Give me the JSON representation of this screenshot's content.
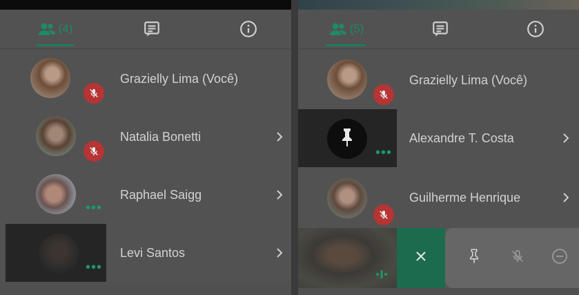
{
  "left_panel": {
    "tabs": {
      "people_count": "(4)",
      "chat_icon": "chat-icon",
      "info_icon": "info-icon"
    },
    "participants": [
      {
        "name": "Grazielly Lima (Você)",
        "status": "muted"
      },
      {
        "name": "Natalia Bonetti",
        "status": "muted"
      },
      {
        "name": "Raphael Saigg",
        "status": "more"
      },
      {
        "name": "Levi Santos",
        "status": "more"
      }
    ]
  },
  "right_panel": {
    "tabs": {
      "people_count": "(5)",
      "chat_icon": "chat-icon",
      "info_icon": "info-icon"
    },
    "participants": [
      {
        "name": "Grazielly Lima (Você)",
        "status": "muted"
      },
      {
        "name": "Alexandre T. Costa",
        "status": "more"
      },
      {
        "name": "Guilherme Henrique",
        "status": "muted"
      }
    ],
    "action_menu": {
      "icons": [
        "close-icon",
        "pin-icon",
        "mute-icon",
        "remove-icon"
      ]
    }
  },
  "colors": {
    "accent": "#1d7f5c",
    "mute_red": "#b73434",
    "background": "#525252",
    "dark_tile": "#252525"
  }
}
